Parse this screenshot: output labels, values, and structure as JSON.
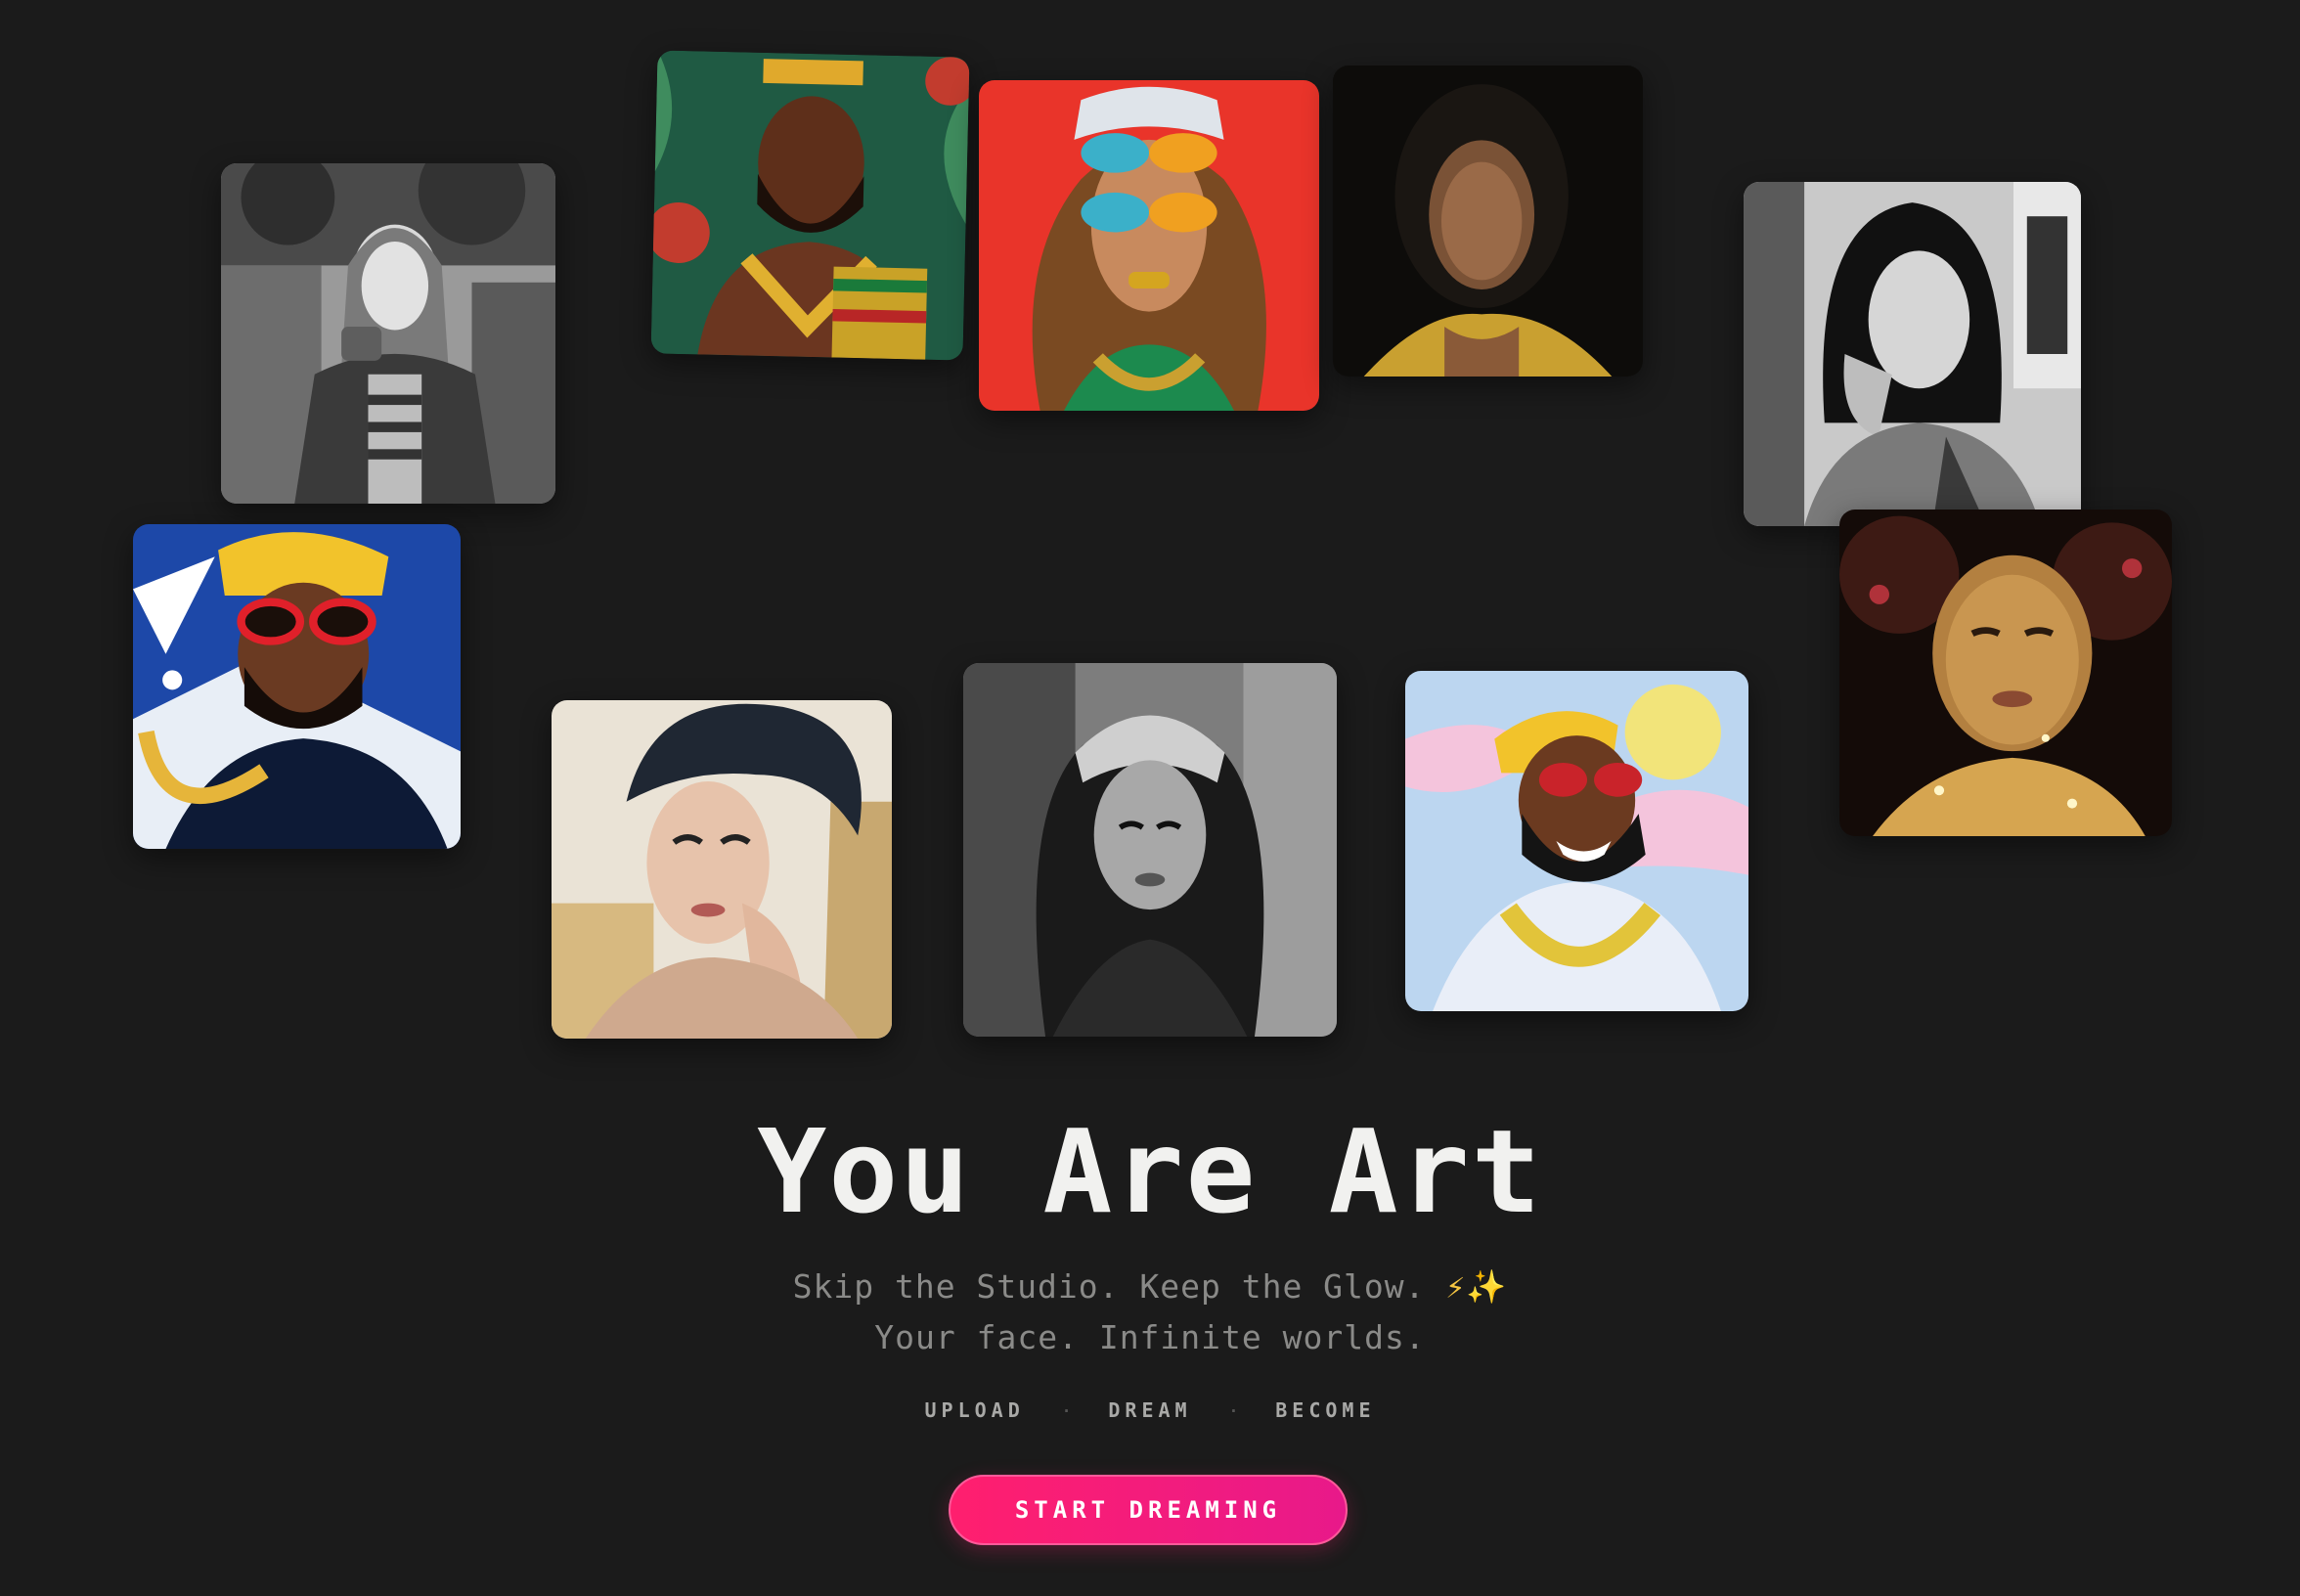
{
  "hero": {
    "title": "You Are Art",
    "subtitle_line1": "Skip the Studio. Keep the Glow.",
    "subtitle_emoji": "⚡✨",
    "subtitle_line2": "Your face. Infinite worlds."
  },
  "steps": {
    "step1": "UPLOAD",
    "step2": "DREAM",
    "step3": "BECOME",
    "separator": "·"
  },
  "cta": {
    "label": "START DREAMING"
  },
  "colors": {
    "background": "#1b1b1b",
    "accent_start": "#ff1f6e",
    "accent_end": "#e8198a",
    "title_text": "#f1f1ef",
    "subtitle_text": "#8a8a88"
  },
  "gallery": {
    "images": [
      {
        "icon": "portrait-woman-coffee-bw-photo"
      },
      {
        "icon": "portrait-man-crown-illustration"
      },
      {
        "icon": "portrait-woman-sunglasses-red"
      },
      {
        "icon": "portrait-woman-blurred-dark"
      },
      {
        "icon": "portrait-woman-bw-photo"
      },
      {
        "icon": "portrait-man-yellow-durag-illustration"
      },
      {
        "icon": "portrait-woman-sketch"
      },
      {
        "icon": "portrait-woman-bandana-bw"
      },
      {
        "icon": "portrait-man-pastel-illustration"
      },
      {
        "icon": "portrait-woman-gold-glitter"
      }
    ]
  }
}
